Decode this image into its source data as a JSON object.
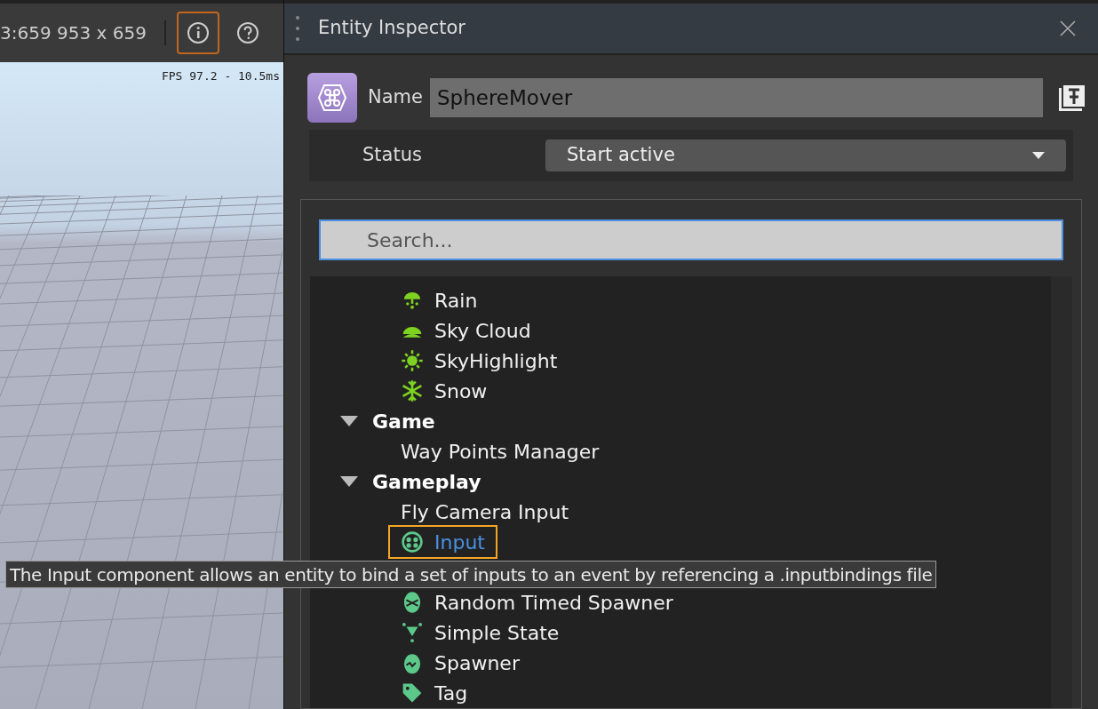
{
  "viewport_toolbar": {
    "coordinates": "3:659 953 x 659",
    "info_button": {
      "selected": true
    }
  },
  "viewport": {
    "fps": "FPS 97.2 - 10.5ms"
  },
  "inspector": {
    "title": "Entity Inspector",
    "name_label": "Name",
    "name_value": "SphereMover",
    "status_label": "Status",
    "status_value": "Start active",
    "search": {
      "placeholder": "Search..."
    },
    "leading_items": [
      {
        "label": "Rain",
        "kind": "icon",
        "selected": false
      },
      {
        "label": "Sky Cloud",
        "kind": "icon",
        "selected": false
      },
      {
        "label": "SkyHighlight",
        "kind": "icon",
        "selected": false
      },
      {
        "label": "Snow",
        "kind": "icon",
        "selected": false
      }
    ],
    "categories": [
      {
        "label": "Game",
        "expanded": true,
        "children": [
          {
            "label": "Way Points Manager",
            "kind": "plain",
            "selected": false
          }
        ]
      },
      {
        "label": "Gameplay",
        "expanded": true,
        "children": [
          {
            "label": "Fly Camera Input",
            "kind": "plain",
            "selected": false
          },
          {
            "label": "Input",
            "kind": "icon",
            "selected": true
          },
          {
            "label": "Random Timed Spawner",
            "kind": "icon",
            "selected": false
          },
          {
            "label": "Simple State",
            "kind": "icon",
            "selected": false
          },
          {
            "label": "Spawner",
            "kind": "icon",
            "selected": false
          },
          {
            "label": "Tag",
            "kind": "icon",
            "selected": false
          }
        ]
      }
    ],
    "tooltip": "The Input component allows an entity to bind a set of inputs to an event by referencing a .inputbindings file"
  }
}
